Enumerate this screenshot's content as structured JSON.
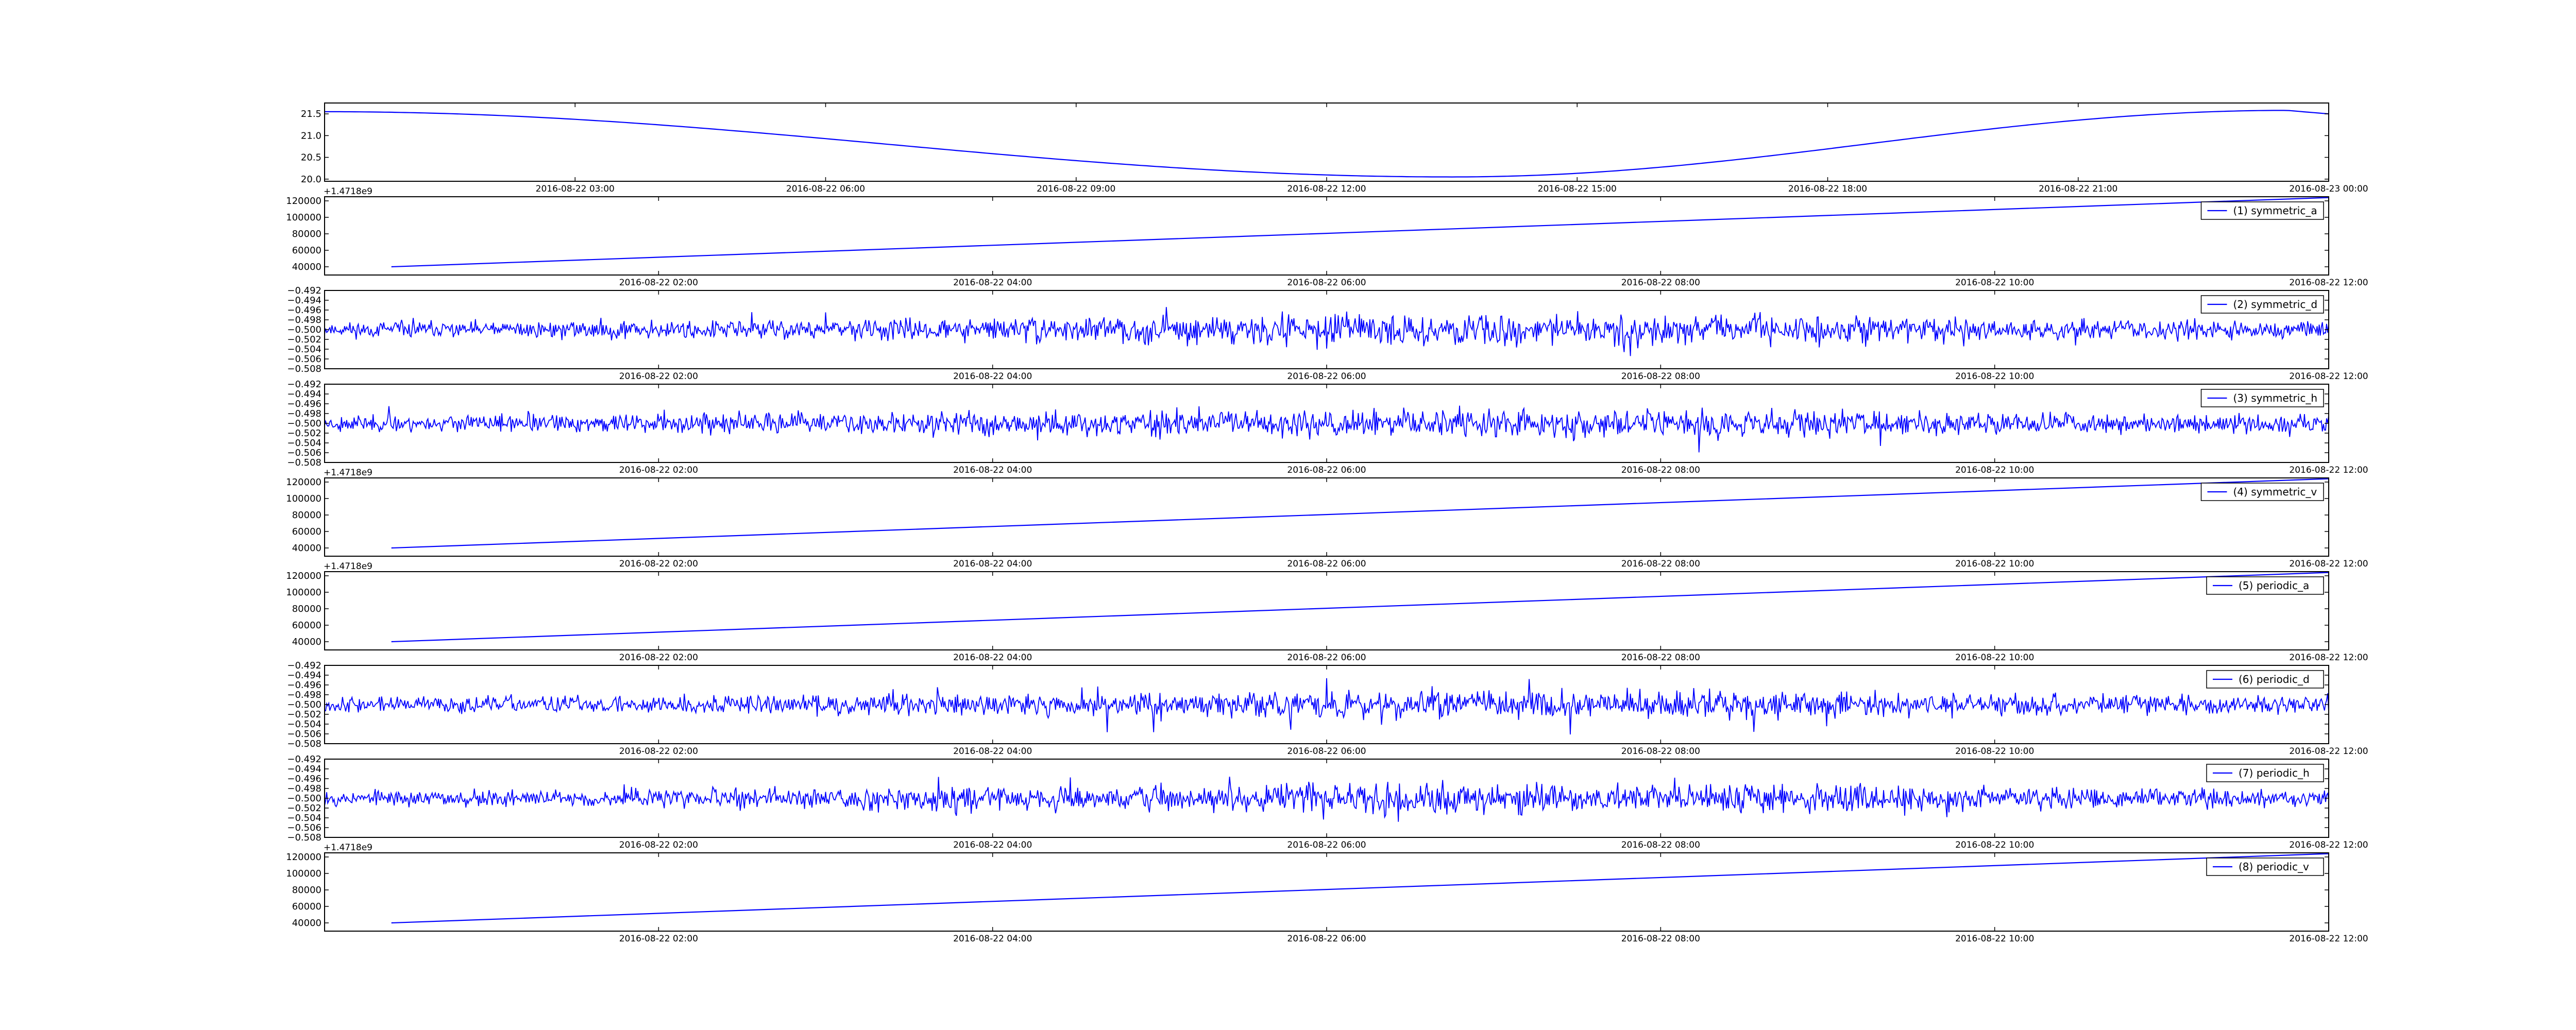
{
  "colors": {
    "line": "#0000ff",
    "axis": "#000000",
    "background": "#ffffff"
  },
  "chart_data": [
    {
      "type": "line",
      "panel": 0,
      "offset_text": "+1.4718e9",
      "ylim": [
        19.95,
        21.75
      ],
      "yticks": [
        "20.0",
        "20.5",
        "21.0",
        "21.5"
      ],
      "ytick_values": [
        20.0,
        20.5,
        21.0,
        21.5
      ],
      "xticks": [
        "2016-08-22 03:00",
        "2016-08-22 06:00",
        "2016-08-22 09:00",
        "2016-08-22 12:00",
        "2016-08-22 15:00",
        "2016-08-22 18:00",
        "2016-08-22 21:00",
        "2016-08-23 00:00"
      ],
      "legend": null,
      "grid": false,
      "series": [
        {
          "kind": "sinusoid",
          "x": [
            "2016-08-22 00:00",
            "2016-08-22 13:30",
            "2016-08-22 23:30",
            "2016-08-23 00:00"
          ],
          "values": [
            21.55,
            20.05,
            21.58,
            21.5
          ]
        }
      ]
    },
    {
      "type": "line",
      "panel": 1,
      "offset_text": "",
      "ylim": [
        30000,
        125000
      ],
      "yticks": [
        "40000",
        "60000",
        "80000",
        "100000",
        "120000"
      ],
      "ytick_values": [
        40000,
        60000,
        80000,
        100000,
        120000
      ],
      "xticks": [
        "2016-08-22 02:00",
        "2016-08-22 04:00",
        "2016-08-22 06:00",
        "2016-08-22 08:00",
        "2016-08-22 10:00",
        "2016-08-22 12:00"
      ],
      "legend": "(1) symmetric_a",
      "legend_position": "top-right",
      "grid": false,
      "series": [
        {
          "name": "(1) symmetric_a",
          "kind": "linear",
          "x": [
            "2016-08-22 00:24",
            "2016-08-22 12:00"
          ],
          "values": [
            40000,
            124000
          ]
        }
      ]
    },
    {
      "type": "line",
      "panel": 2,
      "offset_text": "",
      "ylim": [
        -0.508,
        -0.492
      ],
      "yticks": [
        "−0.508",
        "−0.506",
        "−0.504",
        "−0.502",
        "−0.500",
        "−0.498",
        "−0.496",
        "−0.494",
        "−0.492"
      ],
      "ytick_values": [
        -0.508,
        -0.506,
        -0.504,
        -0.502,
        -0.5,
        -0.498,
        -0.496,
        -0.494,
        -0.492
      ],
      "xticks": [
        "2016-08-22 02:00",
        "2016-08-22 04:00",
        "2016-08-22 06:00",
        "2016-08-22 08:00",
        "2016-08-22 10:00",
        "2016-08-22 12:00"
      ],
      "legend": "(2) symmetric_d",
      "legend_position": "top-right",
      "grid": false,
      "series": [
        {
          "name": "(2) symmetric_d",
          "kind": "noise",
          "center": -0.5,
          "amplitude_envelope": [
            0.0022,
            0.0025,
            0.003,
            0.0034,
            0.0042,
            0.0045,
            0.004,
            0.003,
            0.0025
          ],
          "seed": 11
        }
      ]
    },
    {
      "type": "line",
      "panel": 3,
      "offset_text": "+1.4718e9",
      "ylim": [
        -0.508,
        -0.492
      ],
      "yticks": [
        "−0.508",
        "−0.506",
        "−0.504",
        "−0.502",
        "−0.500",
        "−0.498",
        "−0.496",
        "−0.494",
        "−0.492"
      ],
      "ytick_values": [
        -0.508,
        -0.506,
        -0.504,
        -0.502,
        -0.5,
        -0.498,
        -0.496,
        -0.494,
        -0.492
      ],
      "xticks": [
        "2016-08-22 02:00",
        "2016-08-22 04:00",
        "2016-08-22 06:00",
        "2016-08-22 08:00",
        "2016-08-22 10:00",
        "2016-08-22 12:00"
      ],
      "legend": "(3) symmetric_h",
      "legend_position": "top-right",
      "grid": false,
      "series": [
        {
          "name": "(3) symmetric_h",
          "kind": "noise",
          "center": -0.5,
          "amplitude_envelope": [
            0.0022,
            0.0026,
            0.0032,
            0.0036,
            0.0042,
            0.0044,
            0.0038,
            0.003,
            0.0024
          ],
          "seed": 23
        }
      ]
    },
    {
      "type": "line",
      "panel": 4,
      "offset_text": "+1.4718e9",
      "ylim": [
        30000,
        125000
      ],
      "yticks": [
        "40000",
        "60000",
        "80000",
        "100000",
        "120000"
      ],
      "ytick_values": [
        40000,
        60000,
        80000,
        100000,
        120000
      ],
      "xticks": [
        "2016-08-22 02:00",
        "2016-08-22 04:00",
        "2016-08-22 06:00",
        "2016-08-22 08:00",
        "2016-08-22 10:00",
        "2016-08-22 12:00"
      ],
      "legend": "(4) symmetric_v",
      "legend_position": "top-right",
      "grid": false,
      "series": [
        {
          "name": "(4) symmetric_v",
          "kind": "linear",
          "x": [
            "2016-08-22 00:24",
            "2016-08-22 12:00"
          ],
          "values": [
            40000,
            124000
          ]
        }
      ]
    },
    {
      "type": "line",
      "panel": 5,
      "offset_text": "",
      "ylim": [
        30000,
        125000
      ],
      "yticks": [
        "40000",
        "60000",
        "80000",
        "100000",
        "120000"
      ],
      "ytick_values": [
        40000,
        60000,
        80000,
        100000,
        120000
      ],
      "xticks": [
        "2016-08-22 02:00",
        "2016-08-22 04:00",
        "2016-08-22 06:00",
        "2016-08-22 08:00",
        "2016-08-22 10:00",
        "2016-08-22 12:00"
      ],
      "legend": "(5) periodic_a",
      "legend_position": "top-right",
      "grid": false,
      "series": [
        {
          "name": "(5) periodic_a",
          "kind": "linear",
          "x": [
            "2016-08-22 00:24",
            "2016-08-22 12:00"
          ],
          "values": [
            40000,
            124000
          ]
        }
      ]
    },
    {
      "type": "line",
      "panel": 6,
      "offset_text": "",
      "ylim": [
        -0.508,
        -0.492
      ],
      "yticks": [
        "−0.508",
        "−0.506",
        "−0.504",
        "−0.502",
        "−0.500",
        "−0.498",
        "−0.496",
        "−0.494",
        "−0.492"
      ],
      "ytick_values": [
        -0.508,
        -0.506,
        -0.504,
        -0.502,
        -0.5,
        -0.498,
        -0.496,
        -0.494,
        -0.492
      ],
      "xticks": [
        "2016-08-22 02:00",
        "2016-08-22 04:00",
        "2016-08-22 06:00",
        "2016-08-22 08:00",
        "2016-08-22 10:00",
        "2016-08-22 12:00"
      ],
      "legend": "(6) periodic_d",
      "legend_position": "top-right",
      "grid": false,
      "series": [
        {
          "name": "(6) periodic_d",
          "kind": "noise",
          "center": -0.5,
          "amplitude_envelope": [
            0.0022,
            0.0025,
            0.003,
            0.0034,
            0.0042,
            0.0045,
            0.004,
            0.003,
            0.0025
          ],
          "seed": 37
        }
      ]
    },
    {
      "type": "line",
      "panel": 7,
      "offset_text": "+1.4718e9",
      "ylim": [
        -0.508,
        -0.492
      ],
      "yticks": [
        "−0.508",
        "−0.506",
        "−0.504",
        "−0.502",
        "−0.500",
        "−0.498",
        "−0.496",
        "−0.494",
        "−0.492"
      ],
      "ytick_values": [
        -0.508,
        -0.506,
        -0.504,
        -0.502,
        -0.5,
        -0.498,
        -0.496,
        -0.494,
        -0.492
      ],
      "xticks": [
        "2016-08-22 02:00",
        "2016-08-22 04:00",
        "2016-08-22 06:00",
        "2016-08-22 08:00",
        "2016-08-22 10:00",
        "2016-08-22 12:00"
      ],
      "legend": "(7) periodic_h",
      "legend_position": "top-right",
      "grid": false,
      "series": [
        {
          "name": "(7) periodic_h",
          "kind": "noise",
          "center": -0.5,
          "amplitude_envelope": [
            0.0022,
            0.0026,
            0.0032,
            0.0036,
            0.0042,
            0.0044,
            0.0038,
            0.003,
            0.0024
          ],
          "seed": 53
        }
      ]
    },
    {
      "type": "line",
      "panel": 8,
      "offset_text": "",
      "ylim": [
        30000,
        125000
      ],
      "yticks": [
        "40000",
        "60000",
        "80000",
        "100000",
        "120000"
      ],
      "ytick_values": [
        40000,
        60000,
        80000,
        100000,
        120000
      ],
      "xticks": [
        "2016-08-22 02:00",
        "2016-08-22 04:00",
        "2016-08-22 06:00",
        "2016-08-22 08:00",
        "2016-08-22 10:00",
        "2016-08-22 12:00"
      ],
      "legend": "(8) periodic_v",
      "legend_position": "top-right",
      "grid": false,
      "series": [
        {
          "name": "(8) periodic_v",
          "kind": "linear",
          "x": [
            "2016-08-22 00:24",
            "2016-08-22 12:00"
          ],
          "values": [
            40000,
            124000
          ]
        }
      ]
    }
  ]
}
